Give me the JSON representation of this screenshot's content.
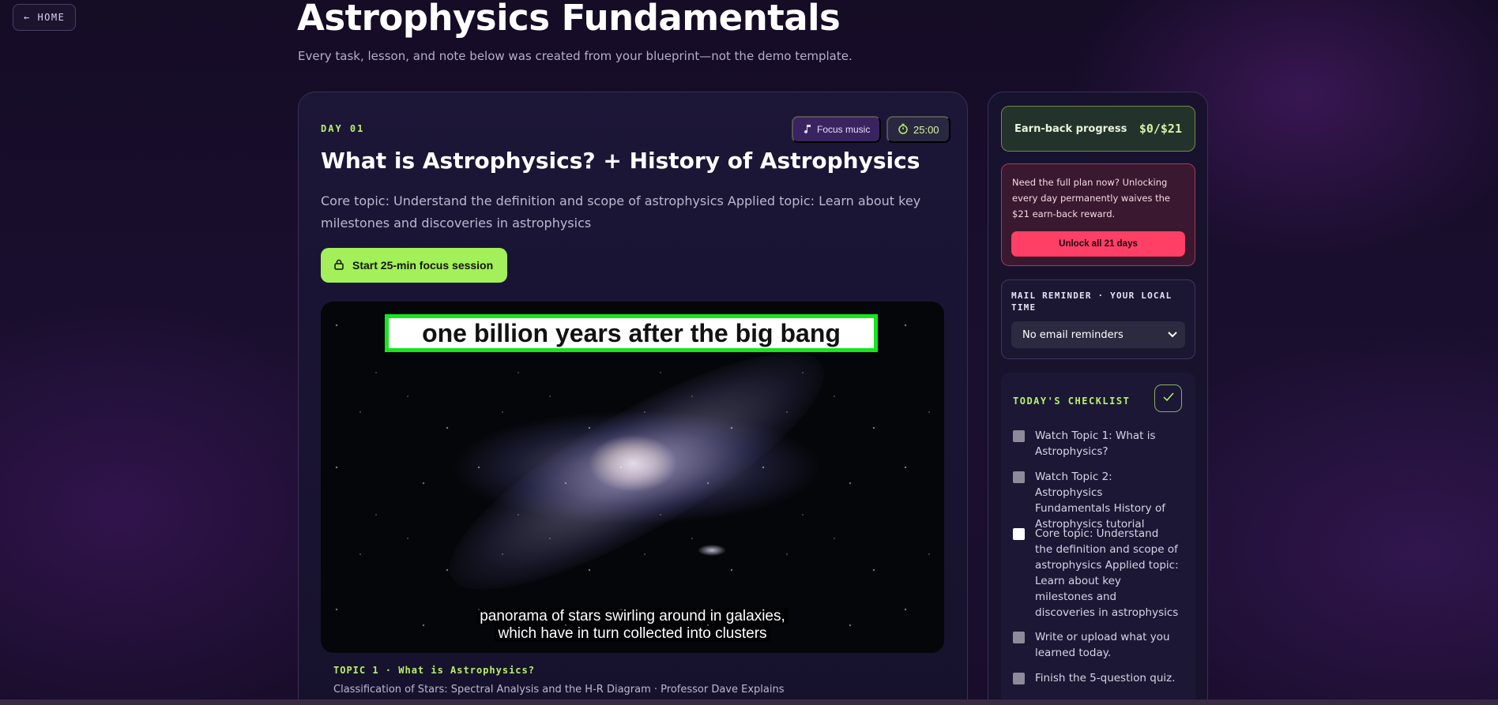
{
  "nav": {
    "home_label": "← HOME"
  },
  "header": {
    "title": "Astrophysics Fundamentals",
    "subtitle": "Every task, lesson, and note below was created from your blueprint—not the demo template."
  },
  "lesson": {
    "day_label": "DAY 01",
    "focus_music_label": "Focus music",
    "timer": "25:00",
    "title": "What is Astrophysics? + History of Astrophysics",
    "description": "Core topic: Understand the definition and scope of astrophysics Applied topic: Learn about key milestones and discoveries in astrophysics",
    "focus_button": "Start 25-min focus session",
    "video": {
      "banner": "one billion years after the big bang",
      "caption_line1": "panorama of stars swirling around in galaxies,",
      "caption_line2": "which have in turn collected into clusters"
    },
    "topic_label": "TOPIC 1 · What is Astrophysics?",
    "topic_video": "Classification of Stars: Spectral Analysis and the H-R Diagram · Professor Dave Explains"
  },
  "sidebar": {
    "earn_back_label": "Earn-back progress",
    "earn_back_value": "$0/$21",
    "unlock_text": "Need the full plan now? Unlocking every day permanently waives the $21 earn-back reward.",
    "unlock_button": "Unlock all 21 days",
    "mail_label": "MAIL REMINDER · YOUR LOCAL TIME",
    "mail_selected": "No email reminders",
    "checklist_title": "TODAY'S CHECKLIST",
    "checklist": [
      {
        "text": "Watch Topic 1: What is Astrophysics?",
        "style": "grey"
      },
      {
        "text": "Watch Topic 2: Astrophysics Fundamentals History of Astrophysics tutorial",
        "style": "grey"
      },
      {
        "text": "Core topic: Understand the definition and scope of astrophysics Applied topic: Learn about key milestones and discoveries in astrophysics",
        "style": "white"
      },
      {
        "text": "Write or upload what you learned today.",
        "style": "grey"
      },
      {
        "text": "Finish the 5-question quiz.",
        "style": "grey"
      }
    ]
  },
  "colors": {
    "accent_green": "#a3f05a",
    "unlock_red": "#ff3f66",
    "background": "#1b0f30"
  }
}
